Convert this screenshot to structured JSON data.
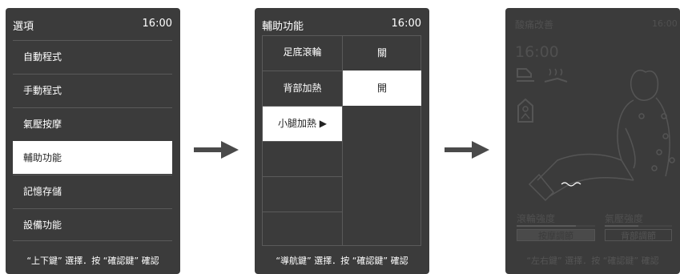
{
  "panel1": {
    "title": "選項",
    "time": "16:00",
    "items": [
      "自動程式",
      "手動程式",
      "氣壓按摩",
      "輔助功能",
      "記憶存儲",
      "設備功能"
    ],
    "selected_index": 3,
    "footer": "“上下鍵” 選擇．按 “確認鍵” 確認"
  },
  "panel2": {
    "title": "輔助功能",
    "time": "16:00",
    "items": [
      {
        "label": "足底滾輪",
        "value": "關"
      },
      {
        "label": "背部加熱",
        "value": "開"
      },
      {
        "label": "小腿加熱 ▶",
        "value": ""
      }
    ],
    "footer": "“導航鍵” 選擇．按 “確認鍵” 確認"
  },
  "panel3": {
    "title": "酸痛改善",
    "time_small": "16:00",
    "time_large": "16:00",
    "roller_label": "滾輪強度",
    "air_label": "氣壓強度",
    "roller_level": 0.75,
    "air_level": 0.5,
    "massage_button": "按摩調節",
    "back_button": "背部調節",
    "footer": "“左右鍵” 選擇．按 “確認鍵” 確認"
  },
  "colors": {
    "panel_bg": "#3b3b3b",
    "selected_bg": "#ffffff",
    "arrow": "#4a4a4a",
    "dimmed": "#555555"
  }
}
